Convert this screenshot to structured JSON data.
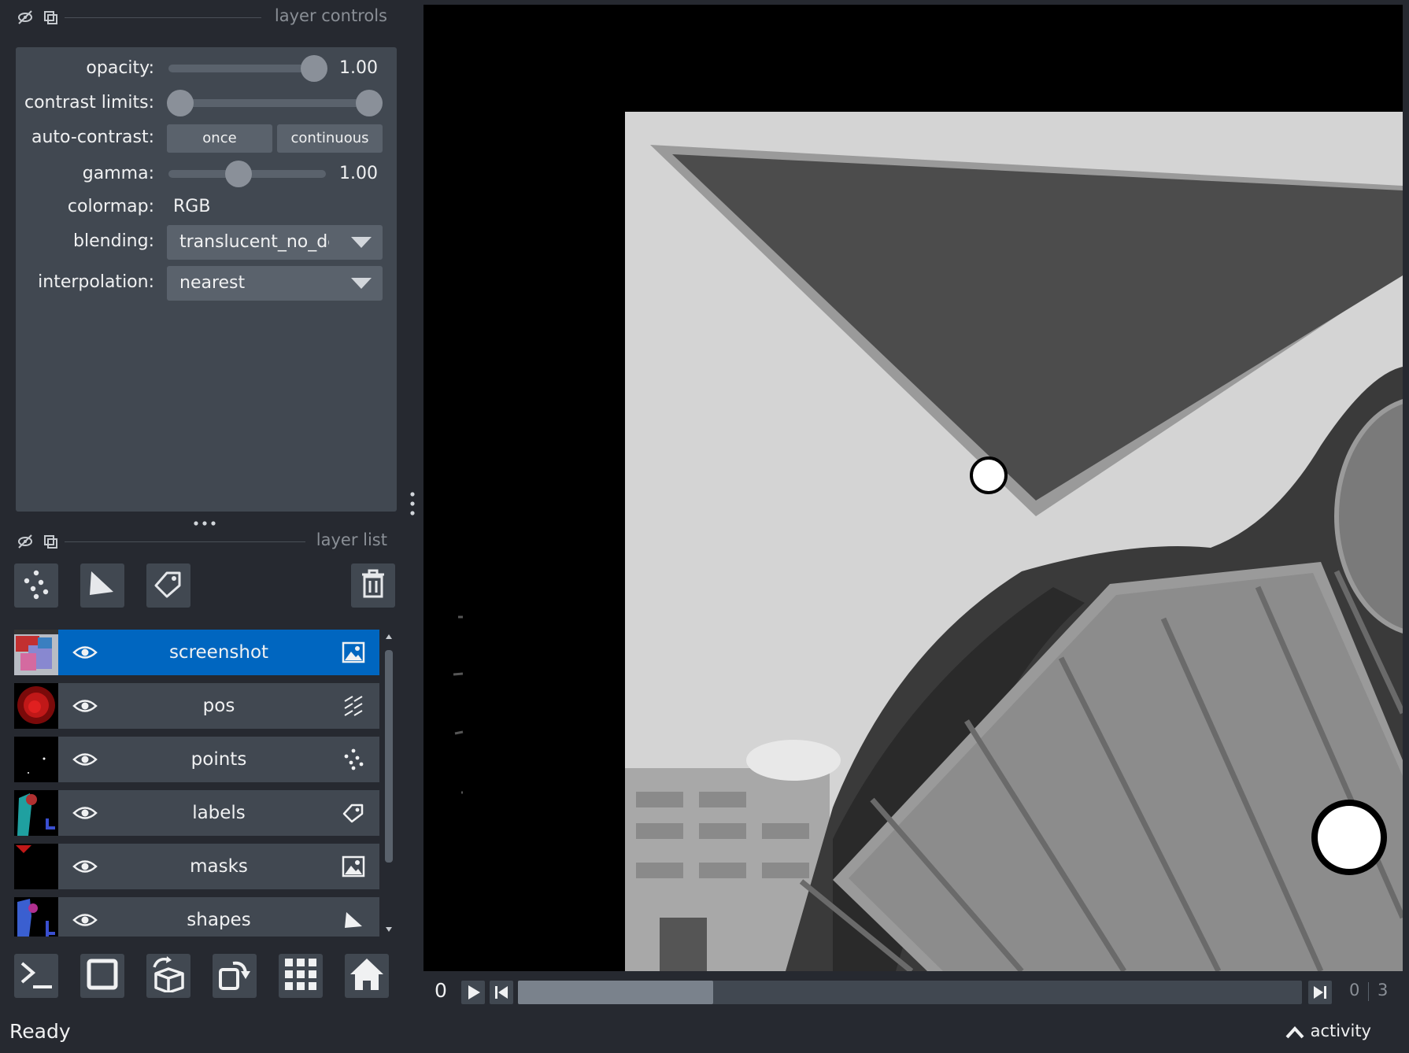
{
  "layer_controls": {
    "title": "layer controls",
    "opacity": {
      "label": "opacity:",
      "value": "1.00",
      "fraction": 1.0
    },
    "contrast_limits": {
      "label": "contrast limits:",
      "low": 0.0,
      "high": 1.0
    },
    "auto_contrast": {
      "label": "auto-contrast:",
      "once_label": "once",
      "continuous_label": "continuous"
    },
    "gamma": {
      "label": "gamma:",
      "value": "1.00",
      "fraction": 0.5
    },
    "colormap": {
      "label": "colormap:",
      "value": "RGB"
    },
    "blending": {
      "label": "blending:",
      "value": "translucent_no_depth"
    },
    "interpolation": {
      "label": "interpolation:",
      "value": "nearest"
    }
  },
  "layer_list": {
    "title": "layer list",
    "layers": [
      {
        "name": "screenshot",
        "type_icon": "image-icon",
        "selected": true
      },
      {
        "name": "pos",
        "type_icon": "vectors-icon",
        "selected": false
      },
      {
        "name": "points",
        "type_icon": "points-icon",
        "selected": false
      },
      {
        "name": "labels",
        "type_icon": "labels-icon",
        "selected": false
      },
      {
        "name": "masks",
        "type_icon": "image-icon",
        "selected": false
      },
      {
        "name": "shapes",
        "type_icon": "shapes-icon",
        "selected": false
      }
    ]
  },
  "dims": {
    "current_label": "0",
    "frame_value": "0",
    "frame_max": "3"
  },
  "status": {
    "text": "Ready",
    "activity_label": "activity"
  },
  "colors": {
    "background": "#262930",
    "panel": "#414851",
    "selected": "#0066c0",
    "control": "#5a626c"
  }
}
